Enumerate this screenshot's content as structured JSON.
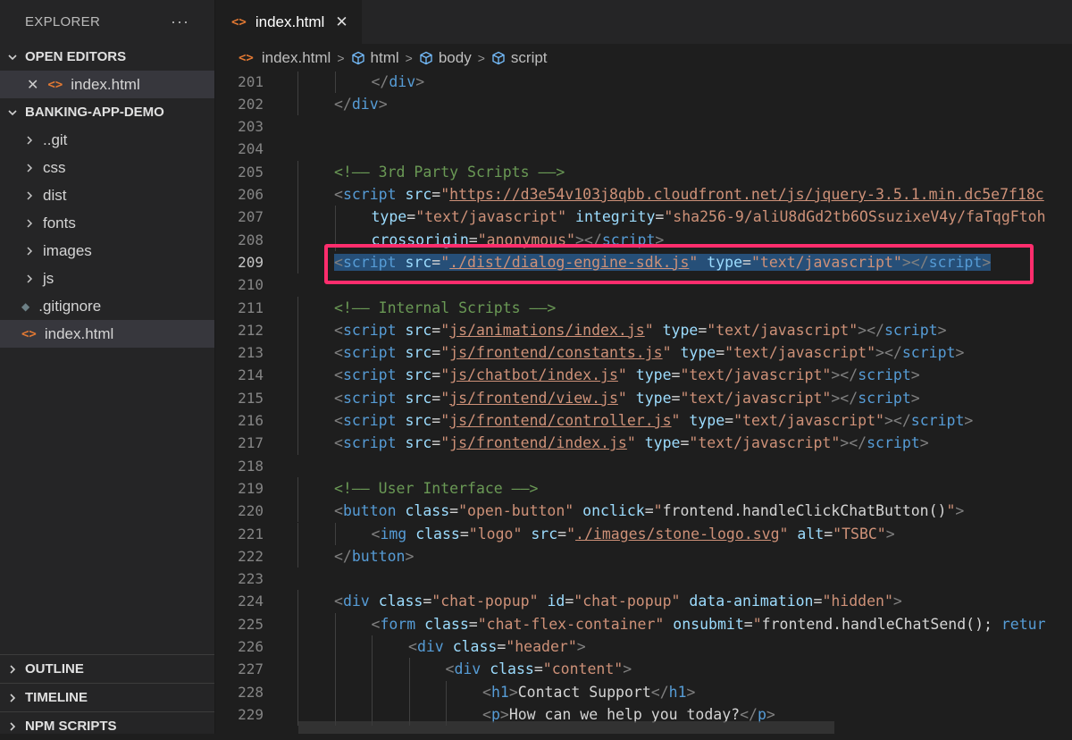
{
  "explorer": {
    "title": "EXPLORER",
    "more": "···",
    "open_editors_label": "OPEN EDITORS",
    "open_editor_file": "index.html",
    "project_label": "BANKING-APP-DEMO",
    "tree": [
      {
        "name": "..git",
        "type": "folder"
      },
      {
        "name": "css",
        "type": "folder"
      },
      {
        "name": "dist",
        "type": "folder"
      },
      {
        "name": "fonts",
        "type": "folder"
      },
      {
        "name": "images",
        "type": "folder"
      },
      {
        "name": "js",
        "type": "folder"
      },
      {
        "name": ".gitignore",
        "type": "file"
      },
      {
        "name": "index.html",
        "type": "file"
      }
    ],
    "outline_label": "OUTLINE",
    "timeline_label": "TIMELINE",
    "npm_scripts_label": "NPM SCRIPTS"
  },
  "tab": {
    "label": "index.html",
    "close": "✕"
  },
  "breadcrumb": {
    "file": "index.html",
    "items": [
      "html",
      "body",
      "script"
    ]
  },
  "colors": {
    "highlight_box": "#ff2d6d",
    "selection": "#264f78",
    "html_icon": "#e37933"
  },
  "code_lines": [
    {
      "n": "201",
      "indent": 2,
      "tokens": [
        [
          "punc",
          "</"
        ],
        [
          "tag",
          "div"
        ],
        [
          "punc",
          ">"
        ]
      ]
    },
    {
      "n": "202",
      "indent": 1,
      "tokens": [
        [
          "punc",
          "</"
        ],
        [
          "tag",
          "div"
        ],
        [
          "punc",
          ">"
        ]
      ]
    },
    {
      "n": "203",
      "indent": 0,
      "tokens": []
    },
    {
      "n": "204",
      "indent": 0,
      "tokens": []
    },
    {
      "n": "205",
      "indent": 1,
      "tokens": [
        [
          "com",
          "<!—— 3rd Party Scripts ——>"
        ]
      ]
    },
    {
      "n": "206",
      "indent": 1,
      "tokens": [
        [
          "punc",
          "<"
        ],
        [
          "tag",
          "script"
        ],
        [
          "txt",
          " "
        ],
        [
          "attr",
          "src"
        ],
        [
          "txt",
          "="
        ],
        [
          "str",
          "\""
        ],
        [
          "url",
          "https://d3e54v103j8qbb.cloudfront.net/js/jquery-3.5.1.min.dc5e7f18c"
        ]
      ]
    },
    {
      "n": "207",
      "indent": 2,
      "tokens": [
        [
          "attr",
          "type"
        ],
        [
          "txt",
          "="
        ],
        [
          "str",
          "\"text/javascript\""
        ],
        [
          "txt",
          " "
        ],
        [
          "attr",
          "integrity"
        ],
        [
          "txt",
          "="
        ],
        [
          "str",
          "\"sha256-9/aliU8dGd2tb6OSsuzixeV4y/faTqgFtoh"
        ]
      ]
    },
    {
      "n": "208",
      "indent": 2,
      "tokens": [
        [
          "attr",
          "crossorigin"
        ],
        [
          "txt",
          "="
        ],
        [
          "str",
          "\"anonymous\""
        ],
        [
          "punc",
          "></"
        ],
        [
          "tag",
          "script"
        ],
        [
          "punc",
          ">"
        ]
      ]
    },
    {
      "n": "209",
      "indent": 1,
      "active": true,
      "selected": true,
      "tokens": [
        [
          "punc",
          "<"
        ],
        [
          "tag",
          "script"
        ],
        [
          "txt",
          " "
        ],
        [
          "attr",
          "src"
        ],
        [
          "txt",
          "="
        ],
        [
          "str",
          "\""
        ],
        [
          "url",
          "./dist/dialog-engine-sdk.js"
        ],
        [
          "str",
          "\""
        ],
        [
          "txt",
          " "
        ],
        [
          "attr",
          "type"
        ],
        [
          "txt",
          "="
        ],
        [
          "str",
          "\"text/javascript\""
        ],
        [
          "punc",
          "></"
        ],
        [
          "tag",
          "script"
        ],
        [
          "punc",
          ">"
        ]
      ]
    },
    {
      "n": "210",
      "indent": 0,
      "tokens": []
    },
    {
      "n": "211",
      "indent": 1,
      "tokens": [
        [
          "com",
          "<!—— Internal Scripts ——>"
        ]
      ]
    },
    {
      "n": "212",
      "indent": 1,
      "tokens": [
        [
          "punc",
          "<"
        ],
        [
          "tag",
          "script"
        ],
        [
          "txt",
          " "
        ],
        [
          "attr",
          "src"
        ],
        [
          "txt",
          "="
        ],
        [
          "str",
          "\""
        ],
        [
          "url",
          "js/animations/index.js"
        ],
        [
          "str",
          "\""
        ],
        [
          "txt",
          " "
        ],
        [
          "attr",
          "type"
        ],
        [
          "txt",
          "="
        ],
        [
          "str",
          "\"text/javascript\""
        ],
        [
          "punc",
          "></"
        ],
        [
          "tag",
          "script"
        ],
        [
          "punc",
          ">"
        ]
      ]
    },
    {
      "n": "213",
      "indent": 1,
      "tokens": [
        [
          "punc",
          "<"
        ],
        [
          "tag",
          "script"
        ],
        [
          "txt",
          " "
        ],
        [
          "attr",
          "src"
        ],
        [
          "txt",
          "="
        ],
        [
          "str",
          "\""
        ],
        [
          "url",
          "js/frontend/constants.js"
        ],
        [
          "str",
          "\""
        ],
        [
          "txt",
          " "
        ],
        [
          "attr",
          "type"
        ],
        [
          "txt",
          "="
        ],
        [
          "str",
          "\"text/javascript\""
        ],
        [
          "punc",
          "></"
        ],
        [
          "tag",
          "script"
        ],
        [
          "punc",
          ">"
        ]
      ]
    },
    {
      "n": "214",
      "indent": 1,
      "tokens": [
        [
          "punc",
          "<"
        ],
        [
          "tag",
          "script"
        ],
        [
          "txt",
          " "
        ],
        [
          "attr",
          "src"
        ],
        [
          "txt",
          "="
        ],
        [
          "str",
          "\""
        ],
        [
          "url",
          "js/chatbot/index.js"
        ],
        [
          "str",
          "\""
        ],
        [
          "txt",
          " "
        ],
        [
          "attr",
          "type"
        ],
        [
          "txt",
          "="
        ],
        [
          "str",
          "\"text/javascript\""
        ],
        [
          "punc",
          "></"
        ],
        [
          "tag",
          "script"
        ],
        [
          "punc",
          ">"
        ]
      ]
    },
    {
      "n": "215",
      "indent": 1,
      "tokens": [
        [
          "punc",
          "<"
        ],
        [
          "tag",
          "script"
        ],
        [
          "txt",
          " "
        ],
        [
          "attr",
          "src"
        ],
        [
          "txt",
          "="
        ],
        [
          "str",
          "\""
        ],
        [
          "url",
          "js/frontend/view.js"
        ],
        [
          "str",
          "\""
        ],
        [
          "txt",
          " "
        ],
        [
          "attr",
          "type"
        ],
        [
          "txt",
          "="
        ],
        [
          "str",
          "\"text/javascript\""
        ],
        [
          "punc",
          "></"
        ],
        [
          "tag",
          "script"
        ],
        [
          "punc",
          ">"
        ]
      ]
    },
    {
      "n": "216",
      "indent": 1,
      "tokens": [
        [
          "punc",
          "<"
        ],
        [
          "tag",
          "script"
        ],
        [
          "txt",
          " "
        ],
        [
          "attr",
          "src"
        ],
        [
          "txt",
          "="
        ],
        [
          "str",
          "\""
        ],
        [
          "url",
          "js/frontend/controller.js"
        ],
        [
          "str",
          "\""
        ],
        [
          "txt",
          " "
        ],
        [
          "attr",
          "type"
        ],
        [
          "txt",
          "="
        ],
        [
          "str",
          "\"text/javascript\""
        ],
        [
          "punc",
          "></"
        ],
        [
          "tag",
          "script"
        ],
        [
          "punc",
          ">"
        ]
      ]
    },
    {
      "n": "217",
      "indent": 1,
      "tokens": [
        [
          "punc",
          "<"
        ],
        [
          "tag",
          "script"
        ],
        [
          "txt",
          " "
        ],
        [
          "attr",
          "src"
        ],
        [
          "txt",
          "="
        ],
        [
          "str",
          "\""
        ],
        [
          "url",
          "js/frontend/index.js"
        ],
        [
          "str",
          "\""
        ],
        [
          "txt",
          " "
        ],
        [
          "attr",
          "type"
        ],
        [
          "txt",
          "="
        ],
        [
          "str",
          "\"text/javascript\""
        ],
        [
          "punc",
          "></"
        ],
        [
          "tag",
          "script"
        ],
        [
          "punc",
          ">"
        ]
      ]
    },
    {
      "n": "218",
      "indent": 0,
      "tokens": []
    },
    {
      "n": "219",
      "indent": 1,
      "tokens": [
        [
          "com",
          "<!—— User Interface ——>"
        ]
      ]
    },
    {
      "n": "220",
      "indent": 1,
      "tokens": [
        [
          "punc",
          "<"
        ],
        [
          "tag",
          "button"
        ],
        [
          "txt",
          " "
        ],
        [
          "attr",
          "class"
        ],
        [
          "txt",
          "="
        ],
        [
          "str",
          "\"open-button\""
        ],
        [
          "txt",
          " "
        ],
        [
          "attr",
          "onclick"
        ],
        [
          "txt",
          "="
        ],
        [
          "str",
          "\""
        ],
        [
          "txt",
          "frontend.handleClickChatButton()"
        ],
        [
          "str",
          "\""
        ],
        [
          "punc",
          ">"
        ]
      ]
    },
    {
      "n": "221",
      "indent": 2,
      "tokens": [
        [
          "punc",
          "<"
        ],
        [
          "tag",
          "img"
        ],
        [
          "txt",
          " "
        ],
        [
          "attr",
          "class"
        ],
        [
          "txt",
          "="
        ],
        [
          "str",
          "\"logo\""
        ],
        [
          "txt",
          " "
        ],
        [
          "attr",
          "src"
        ],
        [
          "txt",
          "="
        ],
        [
          "str",
          "\""
        ],
        [
          "url",
          "./images/stone-logo.svg"
        ],
        [
          "str",
          "\""
        ],
        [
          "txt",
          " "
        ],
        [
          "attr",
          "alt"
        ],
        [
          "txt",
          "="
        ],
        [
          "str",
          "\"TSBC\""
        ],
        [
          "punc",
          ">"
        ]
      ]
    },
    {
      "n": "222",
      "indent": 1,
      "tokens": [
        [
          "punc",
          "</"
        ],
        [
          "tag",
          "button"
        ],
        [
          "punc",
          ">"
        ]
      ]
    },
    {
      "n": "223",
      "indent": 0,
      "tokens": []
    },
    {
      "n": "224",
      "indent": 1,
      "tokens": [
        [
          "punc",
          "<"
        ],
        [
          "tag",
          "div"
        ],
        [
          "txt",
          " "
        ],
        [
          "attr",
          "class"
        ],
        [
          "txt",
          "="
        ],
        [
          "str",
          "\"chat-popup\""
        ],
        [
          "txt",
          " "
        ],
        [
          "attr",
          "id"
        ],
        [
          "txt",
          "="
        ],
        [
          "str",
          "\"chat-popup\""
        ],
        [
          "txt",
          " "
        ],
        [
          "attr",
          "data-animation"
        ],
        [
          "txt",
          "="
        ],
        [
          "str",
          "\"hidden\""
        ],
        [
          "punc",
          ">"
        ]
      ]
    },
    {
      "n": "225",
      "indent": 2,
      "tokens": [
        [
          "punc",
          "<"
        ],
        [
          "tag",
          "form"
        ],
        [
          "txt",
          " "
        ],
        [
          "attr",
          "class"
        ],
        [
          "txt",
          "="
        ],
        [
          "str",
          "\"chat-flex-container\""
        ],
        [
          "txt",
          " "
        ],
        [
          "attr",
          "onsubmit"
        ],
        [
          "txt",
          "="
        ],
        [
          "str",
          "\""
        ],
        [
          "txt",
          "frontend.handleChatSend(); "
        ],
        [
          "tag",
          "retur"
        ]
      ]
    },
    {
      "n": "226",
      "indent": 3,
      "tokens": [
        [
          "punc",
          "<"
        ],
        [
          "tag",
          "div"
        ],
        [
          "txt",
          " "
        ],
        [
          "attr",
          "class"
        ],
        [
          "txt",
          "="
        ],
        [
          "str",
          "\"header\""
        ],
        [
          "punc",
          ">"
        ]
      ]
    },
    {
      "n": "227",
      "indent": 4,
      "tokens": [
        [
          "punc",
          "<"
        ],
        [
          "tag",
          "div"
        ],
        [
          "txt",
          " "
        ],
        [
          "attr",
          "class"
        ],
        [
          "txt",
          "="
        ],
        [
          "str",
          "\"content\""
        ],
        [
          "punc",
          ">"
        ]
      ]
    },
    {
      "n": "228",
      "indent": 5,
      "tokens": [
        [
          "punc",
          "<"
        ],
        [
          "tag",
          "h1"
        ],
        [
          "punc",
          ">"
        ],
        [
          "txt",
          "Contact Support"
        ],
        [
          "punc",
          "</"
        ],
        [
          "tag",
          "h1"
        ],
        [
          "punc",
          ">"
        ]
      ]
    },
    {
      "n": "229",
      "indent": 5,
      "tokens": [
        [
          "punc",
          "<"
        ],
        [
          "tag",
          "p"
        ],
        [
          "punc",
          ">"
        ],
        [
          "txt",
          "How can we help you today?"
        ],
        [
          "punc",
          "</"
        ],
        [
          "tag",
          "p"
        ],
        [
          "punc",
          ">"
        ]
      ]
    }
  ]
}
